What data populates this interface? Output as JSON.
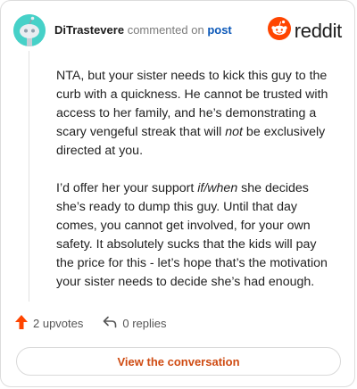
{
  "header": {
    "username": "DiTrastevere",
    "action_text": "commented on",
    "post_link": "post",
    "avatar_icon": "snoo-avatar-icon",
    "brand": {
      "wordmark": "reddit",
      "icon": "reddit-logo-icon",
      "color": "#ff4500"
    }
  },
  "comment": {
    "p1_a": "NTA, but your sister needs to kick this guy to the curb with a quickness. He cannot be trusted with access to her family, and he’s demonstrating a scary vengeful streak that will ",
    "p1_em": "not",
    "p1_b": " be exclusively directed at you.",
    "p2_a": "I’d offer her your support ",
    "p2_em": "if/when",
    "p2_b": " she decides she’s ready to dump this guy. Until that day comes, you cannot get involved, for your own safety. It absolutely sucks that the kids will pay the price for this - let’s hope that’s the motivation your sister needs to decide she’s had enough."
  },
  "actions": {
    "upvotes": "2 upvotes",
    "upvote_icon": "upvote-arrow-icon",
    "upvote_color": "#ff4500",
    "replies": "0 replies",
    "reply_icon": "reply-arrow-icon"
  },
  "cta": {
    "label": "View the conversation",
    "color": "#cf4b12"
  }
}
